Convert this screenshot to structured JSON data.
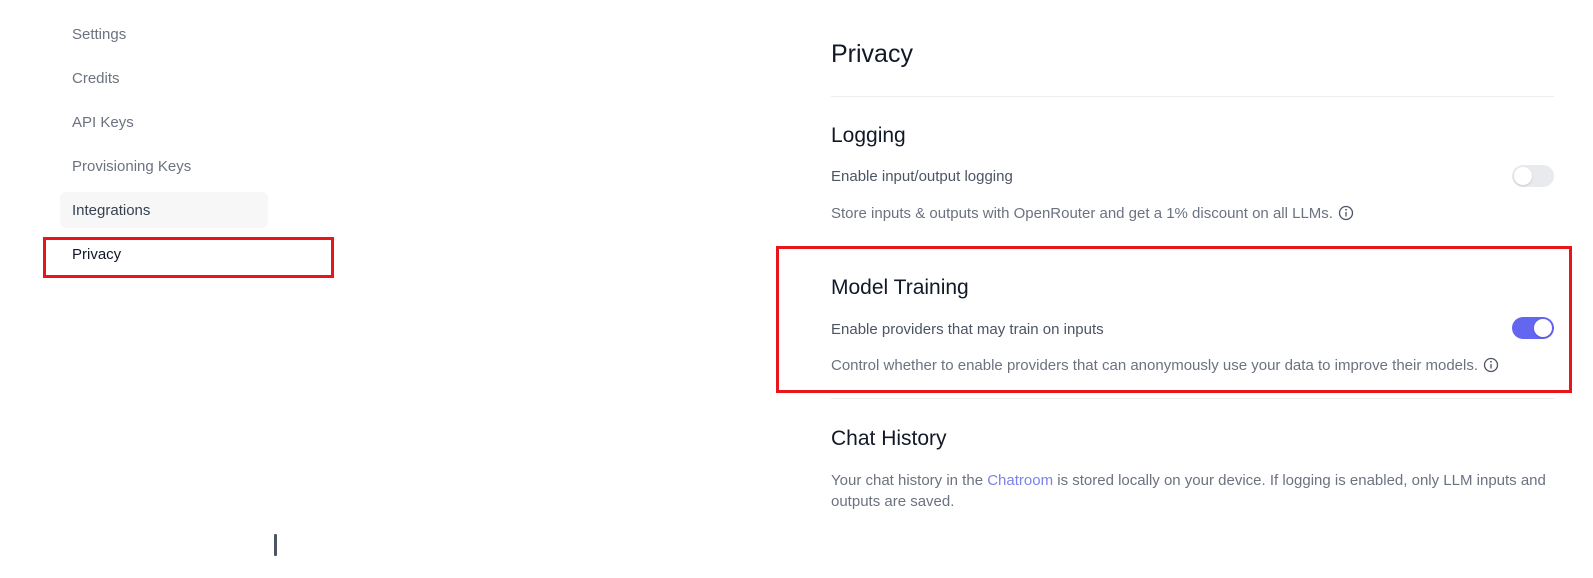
{
  "sidebar": {
    "items": [
      {
        "label": "Settings"
      },
      {
        "label": "Credits"
      },
      {
        "label": "API Keys"
      },
      {
        "label": "Provisioning Keys"
      },
      {
        "label": "Integrations"
      },
      {
        "label": "Privacy"
      }
    ]
  },
  "main": {
    "title": "Privacy",
    "logging": {
      "title": "Logging",
      "label": "Enable input/output logging",
      "enabled": false,
      "description": "Store inputs & outputs with OpenRouter and get a 1% discount on all LLMs."
    },
    "model_training": {
      "title": "Model Training",
      "label": "Enable providers that may train on inputs",
      "enabled": true,
      "description": "Control whether to enable providers that can anonymously use your data to improve their models."
    },
    "chat_history": {
      "title": "Chat History",
      "desc_before": "Your chat history in the ",
      "link": "Chatroom",
      "desc_after": " is stored locally on your device. If logging is enabled, only LLM inputs and outputs are saved."
    }
  },
  "colors": {
    "accent": "#6366f1",
    "highlight": "#e8151b",
    "link": "#7c83e8"
  },
  "icons": [
    "info-icon"
  ]
}
